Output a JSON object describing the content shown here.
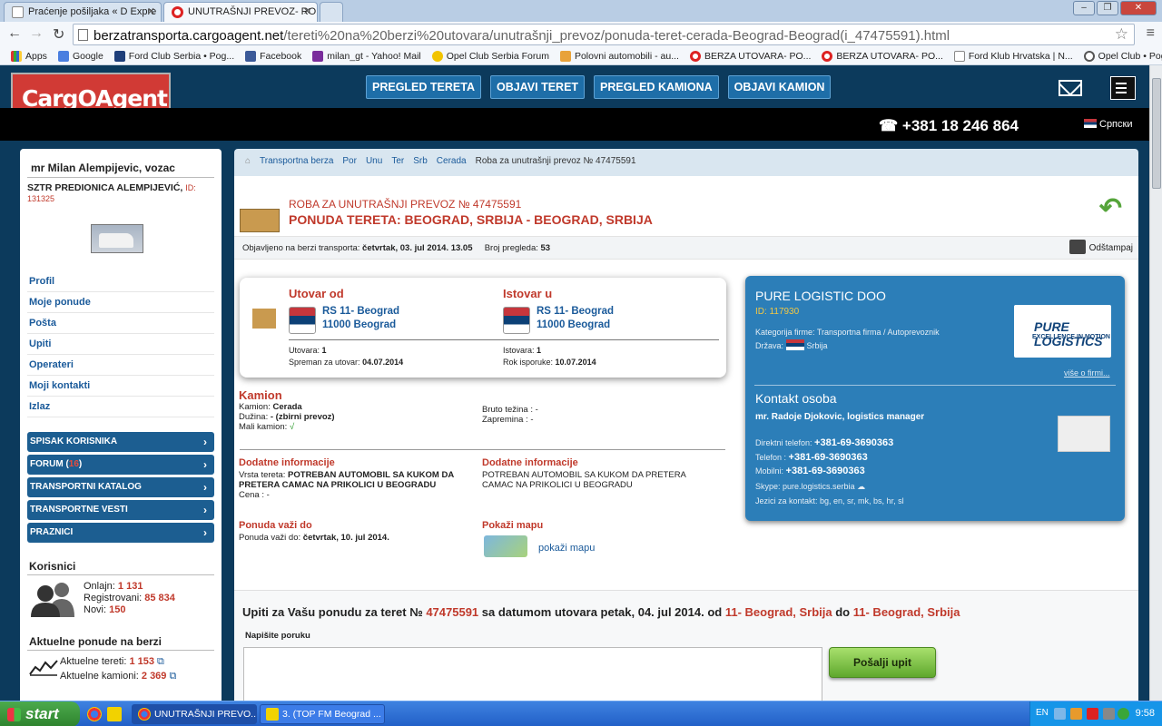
{
  "browser": {
    "tabs": [
      {
        "title": "Praćenje pošiljaka « D Expre",
        "active": false
      },
      {
        "title": "UNUTRAŠNJI PREVOZ- ROBA",
        "active": true
      }
    ],
    "url_prefix": "berzatransporta.cargoagent.net",
    "url_path": "/tereti%20na%20berzi%20utovara/unutrašnji_prevoz/ponuda-teret-cerada-Beograd-Beograd(i_47475591).html",
    "bookmarks": [
      "Apps",
      "Google",
      "Ford Club Serbia • Pog...",
      "Facebook",
      "milan_gt - Yahoo! Mail",
      "Opel Club Serbia Forum",
      "Polovni automobili - au...",
      "BERZA UTOVARA- PO...",
      "BERZA UTOVARA- PO...",
      "Ford Klub Hrvatska | N...",
      "Opel Club • Pogledajte..."
    ]
  },
  "site": {
    "logo": "CargOAgent",
    "nav": [
      "PREGLED TERETA",
      "OBJAVI TERET",
      "PREGLED KAMIONA",
      "OBJAVI KAMION"
    ],
    "phone": "+381 18 246 864",
    "language": "Српски"
  },
  "sidebar": {
    "user": "mr Milan Alempijevic, vozac",
    "company": "SZTR PREDIONICA ALEMPIJEVIĆ,",
    "company_id": "ID: 131325",
    "menu": [
      "Profil",
      "Moje ponude",
      "Pošta",
      "Upiti",
      "Operateri",
      "Moji kontakti",
      "Izlaz"
    ],
    "buttons": {
      "spisak": "SPISAK KORISNIKA",
      "forum": "FORUM (",
      "forum_count": "16",
      "forum_close": ")",
      "katalog": "TRANSPORTNI KATALOG",
      "vesti": "TRANSPORTNE VESTI",
      "praznici": "PRAZNICI"
    },
    "korisnici_title": "Korisnici",
    "online_label": "Onlajn:",
    "online": "1 131",
    "registered_label": "Registrovani:",
    "registered": "85 834",
    "new_label": "Novi:",
    "new": "150",
    "offers_title": "Aktuelne ponude na berzi",
    "loads_label": "Aktuelne tereti:",
    "loads": "1 153",
    "trucks_label": "Aktuelne kamioni:",
    "trucks": "2 369"
  },
  "breadcrumb": [
    "Transportna berza",
    "Por",
    "Unu",
    "Ter",
    "Srb",
    "Cerada",
    "Roba za unutrašnji prevoz № 47475591"
  ],
  "offer": {
    "ref": "ROBA ZA UNUTRAŠNJI PREVOZ № 47475591",
    "title": "PONUDA TERETA: BEOGRAD, SRBIJA - BEOGRAD, SRBIJA",
    "published_label": "Objavljeno na berzi transporta:",
    "published": "četvrtak, 03. jul 2014. 13.05",
    "views_label": "Broj pregleda:",
    "views": "53",
    "print": "Odštampaj",
    "loading_title": "Utovar od",
    "loading_line1": "RS 11- Beograd",
    "loading_line2": "11000 Beograd",
    "loading_count_label": "Utovara:",
    "loading_count": "1",
    "ready_label": "Spreman za utovar:",
    "ready": "04.07.2014",
    "unloading_title": "Istovar u",
    "unloading_line1": "RS 11- Beograd",
    "unloading_line2": "11000 Beograd",
    "unloading_count_label": "Istovara:",
    "unloading_count": "1",
    "delivery_label": "Rok isporuke:",
    "delivery": "10.07.2014",
    "truck_title": "Kamion",
    "truck_type_label": "Kamion:",
    "truck_type": "Cerada",
    "length_label": "Dužina:",
    "length": "- (zbirni prevoz)",
    "small_truck_label": "Mali kamion:",
    "small_truck": "√",
    "gross_label": "Bruto težina :",
    "gross": "-",
    "volume_label": "Zapremina :",
    "volume": "-",
    "extra_title": "Dodatne informacije",
    "cargo_type_label": "Vrsta tereta:",
    "cargo_type": "POTREBAN AUTOMOBIL SA KUKOM DA PRETERA CAMAC NA PRIKOLICI U BEOGRADU",
    "price_label": "Cena :",
    "price": "-",
    "extra_title2": "Dodatne informacije",
    "extra_text": "POTREBAN AUTOMOBIL SA KUKOM DA PRETERA CAMAC NA PRIKOLICI U BEOGRADU",
    "valid_title": "Ponuda važi do",
    "valid_label": "Ponuda važi do:",
    "valid": "četvrtak, 10. jul 2014.",
    "map_title": "Pokaži mapu",
    "map_link": "pokaži mapu"
  },
  "company": {
    "name": "PURE LOGISTIC DOO",
    "id": "ID: 117930",
    "category": "Kategorija firme: Transportna firma / Autoprevoznik",
    "country_label": "Država:",
    "country": "Srbija",
    "logo_text": "PURE LOGISTICS",
    "logo_sub": "EXCELLENCE IN MOTION",
    "more": "više o firmi...",
    "contact_title": "Kontakt osoba",
    "contact_name": "mr. Radoje Djokovic, logistics manager",
    "direct_label": "Direktni telefon:",
    "direct": "+381-69-3690363",
    "phone_label": "Telefon :",
    "phone": "+381-69-3690363",
    "mobile_label": "Mobilni:",
    "mobile": "+381-69-3690363",
    "skype_label": "Skype:",
    "skype": "pure.logistics.serbia",
    "languages": "Jezici za kontakt: bg, en, sr, mk, bs, hr, sl"
  },
  "inquiry": {
    "t1": "Upiti za Vašu ponudu za teret №",
    "num": "47475591",
    "t2": "sa datumom utovara petak, 04. jul 2014. od",
    "from": "11- Beograd, Srbija",
    "t3": "do",
    "to": "11- Beograd, Srbija",
    "label": "Napišite poruku",
    "send": "Pošalji upit"
  },
  "taskbar": {
    "start": "start",
    "items": [
      "UNUTRAŠNJI PREVO...",
      "3. (TOP FM Beograd ..."
    ],
    "lang": "EN",
    "clock": "9:58"
  }
}
